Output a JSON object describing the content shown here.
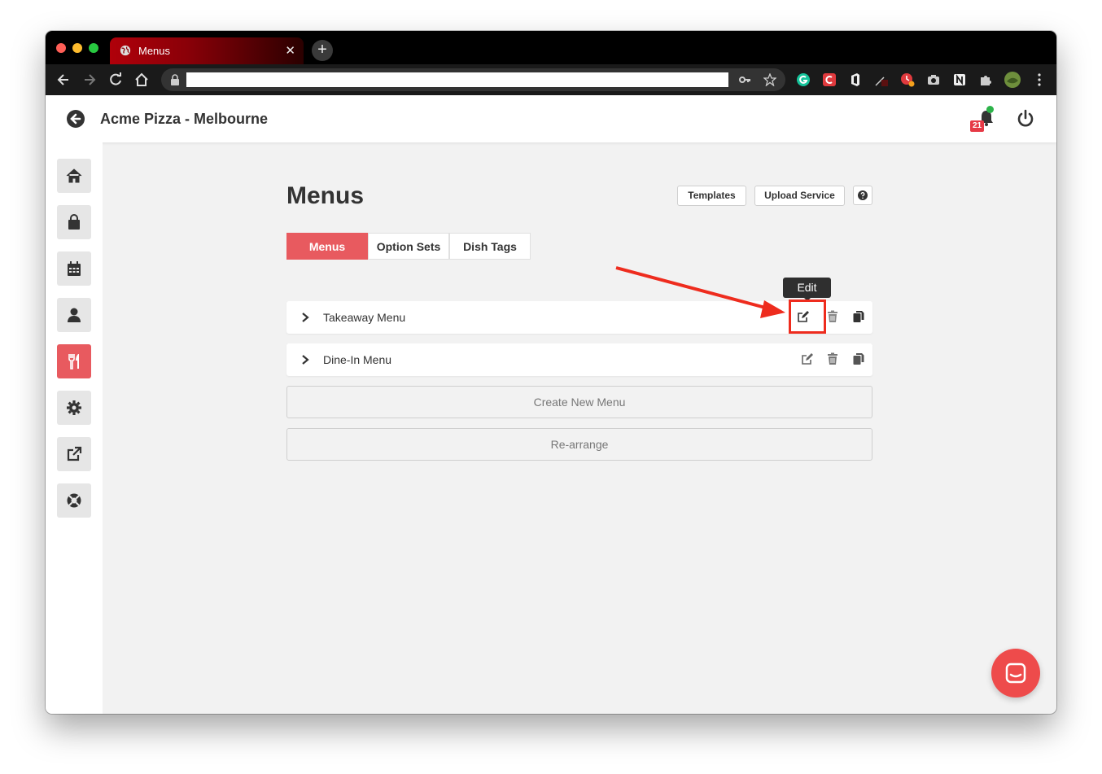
{
  "browser": {
    "tab_title": "Menus",
    "tab_close": "✕",
    "new_tab": "+",
    "address_value": ""
  },
  "header": {
    "store_name": "Acme Pizza - Melbourne",
    "notification_count": "21"
  },
  "sidebar": {
    "items": [
      {
        "name": "home",
        "icon": "home-icon"
      },
      {
        "name": "orders",
        "icon": "shopping-bag-icon"
      },
      {
        "name": "bookings",
        "icon": "calendar-icon"
      },
      {
        "name": "customers",
        "icon": "user-icon"
      },
      {
        "name": "menus",
        "icon": "utensils-icon",
        "active": true
      },
      {
        "name": "settings",
        "icon": "gear-icon"
      },
      {
        "name": "external-link",
        "icon": "external-link-icon"
      },
      {
        "name": "support",
        "icon": "lifebuoy-icon"
      }
    ]
  },
  "main": {
    "title": "Menus",
    "buttons": {
      "templates": "Templates",
      "upload_service": "Upload Service"
    },
    "tabs": [
      {
        "label": "Menus",
        "active": true
      },
      {
        "label": "Option Sets"
      },
      {
        "label": "Dish Tags"
      }
    ],
    "menus": [
      {
        "label": "Takeaway Menu"
      },
      {
        "label": "Dine-In Menu"
      }
    ],
    "create_button": "Create New Menu",
    "rearrange_button": "Re-arrange"
  },
  "annotation": {
    "tooltip": "Edit",
    "color": "#ee2c1e"
  },
  "colors": {
    "accent": "#e85a5f",
    "chat": "#ee4b4b"
  }
}
